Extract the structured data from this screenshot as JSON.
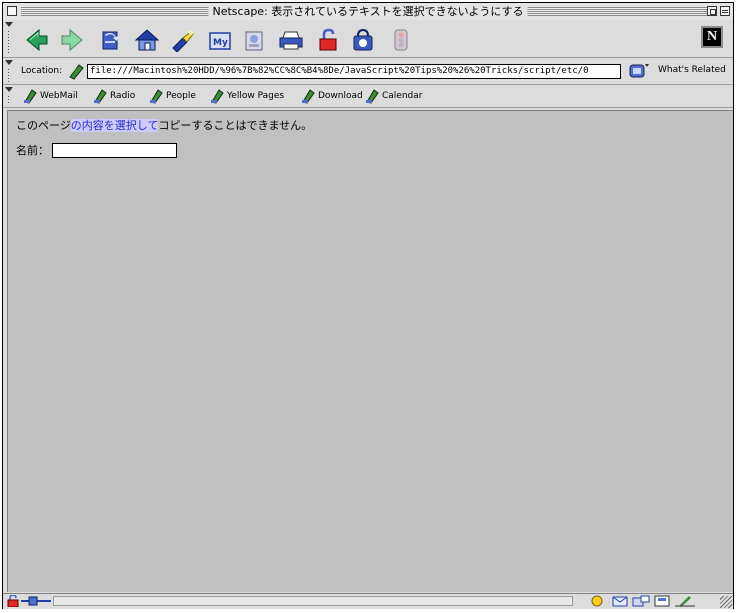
{
  "window": {
    "title": "Netscape: 表示されているテキストを選択できないようにする"
  },
  "nav_toolbar": {
    "buttons": [
      {
        "name": "back"
      },
      {
        "name": "forward"
      },
      {
        "name": "reload"
      },
      {
        "name": "home"
      },
      {
        "name": "search"
      },
      {
        "name": "my-netscape"
      },
      {
        "name": "images"
      },
      {
        "name": "print"
      },
      {
        "name": "security"
      },
      {
        "name": "shop"
      },
      {
        "name": "stop"
      }
    ],
    "logo": "N"
  },
  "location_bar": {
    "label": "Location:",
    "url": "file:///Macintosh%20HDD/%96%7B%82%CC%8C%B4%8De/JavaScript%20Tips%20%26%20Tricks/script/etc/0",
    "related_label": "What's Related"
  },
  "personal_toolbar": {
    "items": [
      {
        "label": "WebMail"
      },
      {
        "label": "Radio"
      },
      {
        "label": "People"
      },
      {
        "label": "Yellow Pages"
      },
      {
        "label": "Download"
      },
      {
        "label": "Calendar"
      }
    ]
  },
  "page": {
    "sentence_before": "このページ",
    "sentence_selected": "の内容を選択して",
    "sentence_after": "コピーすることはできません。",
    "name_label": "名前：",
    "name_value": ""
  },
  "colors": {
    "content_bg": "#c0c0c0",
    "selection_bg": "#ccccff",
    "selection_text": "#2a2ad6"
  }
}
